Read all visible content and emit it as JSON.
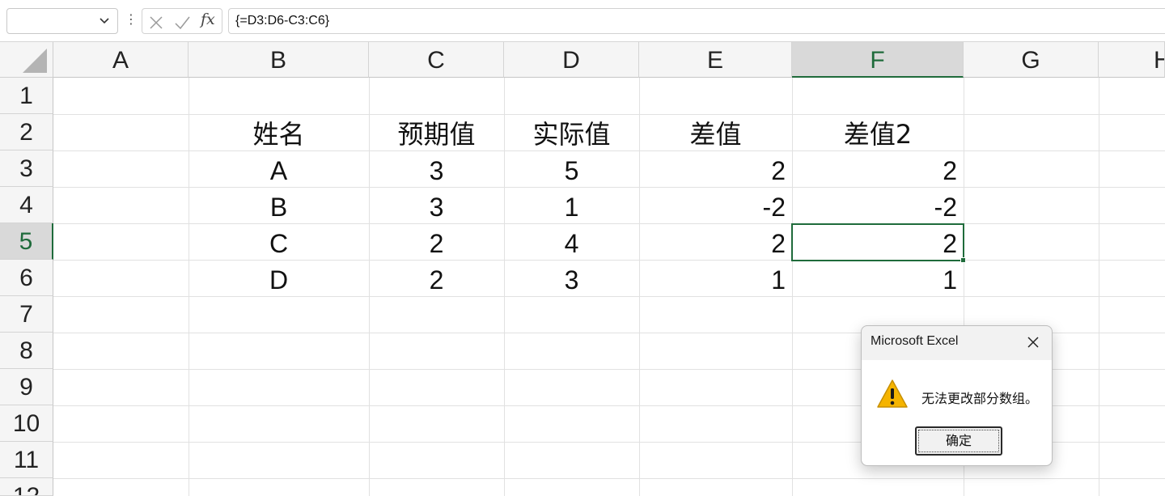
{
  "formula_bar": {
    "name_box_value": "",
    "formula": "{=D3:D6-C3:C6}",
    "fx_label": "fx",
    "icons": [
      "chevron-down-icon",
      "more-options-icon",
      "cancel-x-icon",
      "confirm-check-icon",
      "insert-function-icon"
    ]
  },
  "columns": [
    "A",
    "B",
    "C",
    "D",
    "E",
    "F",
    "G",
    "H"
  ],
  "rows": [
    "1",
    "2",
    "3",
    "4",
    "5",
    "6",
    "7",
    "8",
    "9",
    "10",
    "11",
    "12"
  ],
  "table": {
    "headers": [
      "姓名",
      "预期值",
      "实际值",
      "差值",
      "差值2"
    ],
    "rows": [
      [
        "A",
        "3",
        "5",
        "2",
        "2"
      ],
      [
        "B",
        "3",
        "1",
        "-2",
        "-2"
      ],
      [
        "C",
        "2",
        "4",
        "2",
        "2"
      ],
      [
        "D",
        "2",
        "3",
        "1",
        "1"
      ]
    ]
  },
  "selection": {
    "active_column": "F",
    "active_row": "5"
  },
  "dialog": {
    "title": "Microsoft Excel",
    "message": "无法更改部分数组。",
    "ok_label": "确定",
    "icon": "warning-icon"
  },
  "colors": {
    "selection_green": "#1f6b3b",
    "warning_yellow": "#f5b400",
    "header_bg": "#f5f5f5"
  }
}
